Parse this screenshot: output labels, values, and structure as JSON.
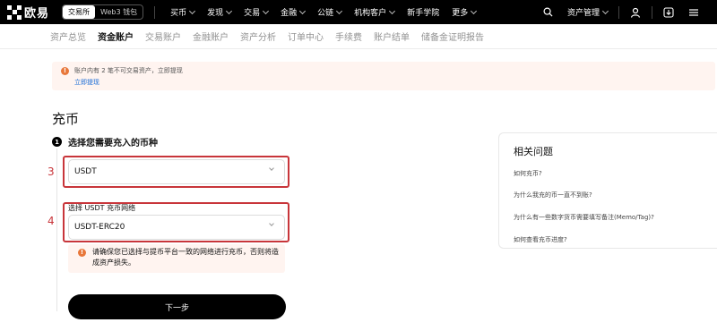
{
  "brand": {
    "name": "欧易"
  },
  "switch": {
    "exchange": "交易所",
    "wallet": "Web3 钱包"
  },
  "nav": [
    "买币",
    "发现",
    "交易",
    "金融",
    "公链",
    "机构客户",
    "新手学院",
    "更多"
  ],
  "nav_right": {
    "asset_mgmt": "资产管理"
  },
  "icons": {
    "search": "search-icon",
    "user": "user-icon",
    "download": "download-icon",
    "menu": "menu-icon"
  },
  "subnav": [
    "资产总览",
    "资金账户",
    "交易账户",
    "金融账户",
    "资产分析",
    "订单中心",
    "手续费",
    "账户结单",
    "储备金证明报告"
  ],
  "subnav_active_index": 1,
  "notice": {
    "text": "账户内有 2 笔不可交易资产，立即提现",
    "link": "立即提现"
  },
  "page_title": "充币",
  "step1": {
    "badge": "1",
    "label": "选择您需要充入的币种"
  },
  "coin_select": {
    "value": "USDT"
  },
  "network": {
    "label": "选择 USDT 充币网络",
    "value": "USDT-ERC20"
  },
  "network_warning": "请确保您已选择与提币平台一致的网络进行充币，否则将造成资产损失。",
  "next_button": "下一步",
  "markers": {
    "coin": "3",
    "network": "4"
  },
  "faq": {
    "title": "相关问题",
    "items": [
      "如何充币?",
      "为什么我充的币一直不到账?",
      "为什么有一些数字货币需要填写备注(Memo/Tag)?",
      "如何查看充币进度?"
    ]
  },
  "colors": {
    "accent": "#000000",
    "highlight": "#c8353a",
    "warning": "#e8773a",
    "link": "#1a6cd6"
  }
}
